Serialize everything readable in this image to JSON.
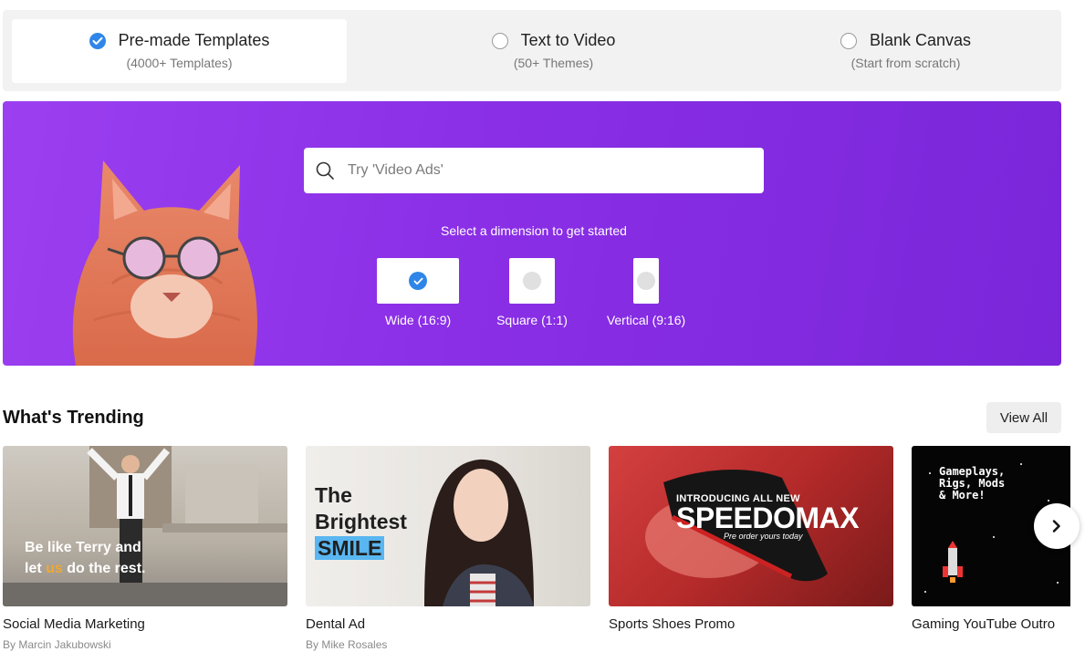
{
  "options": [
    {
      "title": "Pre-made Templates",
      "sub": "(4000+ Templates)",
      "selected": true
    },
    {
      "title": "Text to Video",
      "sub": "(50+ Themes)",
      "selected": false
    },
    {
      "title": "Blank Canvas",
      "sub": "(Start from scratch)",
      "selected": false
    }
  ],
  "hero": {
    "search_placeholder": "Try 'Video Ads'",
    "dimension_prompt": "Select a dimension to get started",
    "dimensions": [
      {
        "label": "Wide (16:9)",
        "selected": true
      },
      {
        "label": "Square (1:1)",
        "selected": false
      },
      {
        "label": "Vertical (9:16)",
        "selected": false
      }
    ],
    "bg_color": "#8a2fe6"
  },
  "trending": {
    "title": "What's Trending",
    "view_all": "View All",
    "cards": [
      {
        "name": "Social Media Marketing",
        "author": "By Marcin Jakubowski",
        "overlay_line1": "Be like Terry and",
        "overlay_line2_pre": "let ",
        "overlay_line2_accent": "us",
        "overlay_line2_post": " do the rest."
      },
      {
        "name": "Dental Ad",
        "author": "By Mike Rosales",
        "overlay_line1": "The",
        "overlay_line2": "Brightest",
        "overlay_line3": "SMILE"
      },
      {
        "name": "Sports Shoes Promo",
        "author": "",
        "overlay_line1": "INTRODUCING ALL NEW",
        "overlay_line2": "SPEEDOMAX",
        "overlay_line3": "Pre order yours today"
      },
      {
        "name": "Gaming YouTube Outro",
        "author": "",
        "overlay_line1": "Gameplays,",
        "overlay_line2": "Rigs, Mods",
        "overlay_line3": "& More!"
      }
    ]
  },
  "accent_color": "#2f86e8"
}
